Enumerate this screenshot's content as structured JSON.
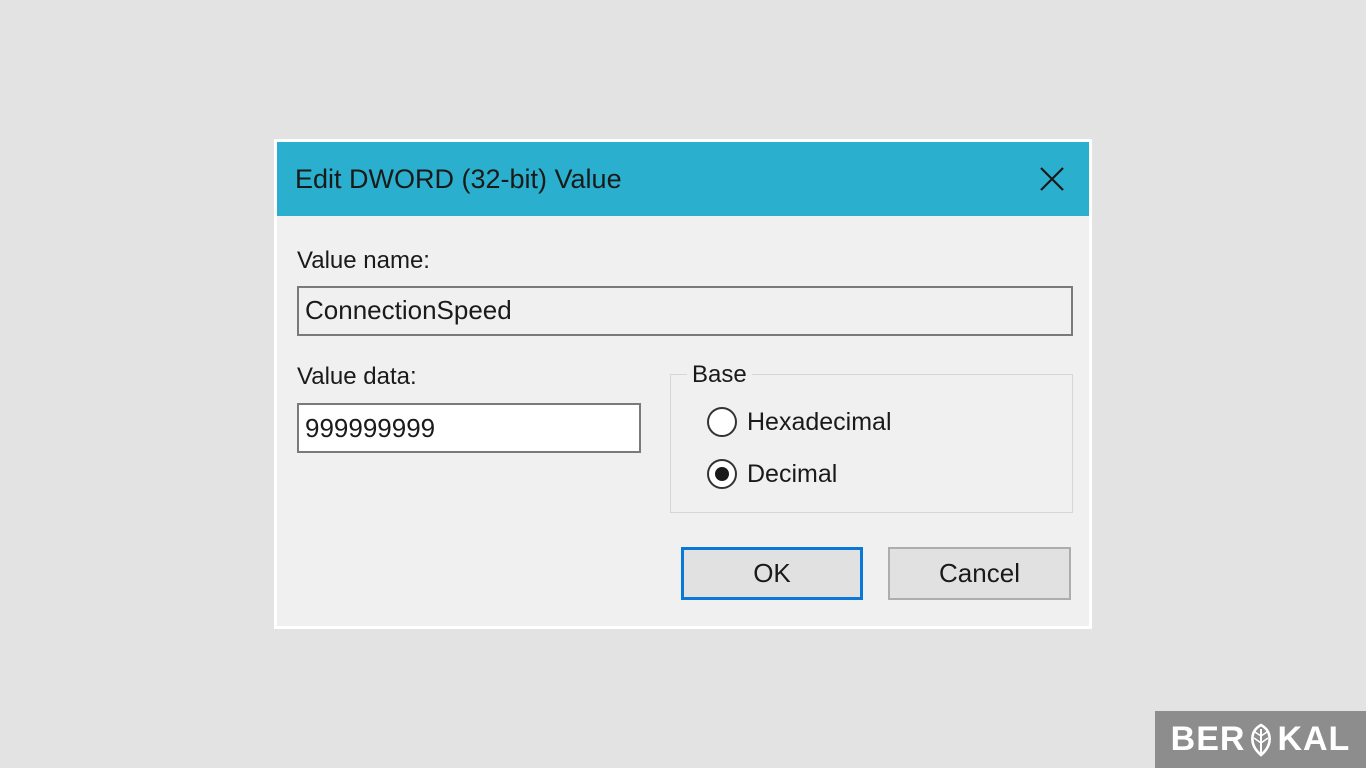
{
  "dialog": {
    "title": "Edit DWORD (32-bit) Value",
    "value_name_label": "Value name:",
    "value_name": "ConnectionSpeed",
    "value_data_label": "Value data:",
    "value_data": "999999999",
    "base": {
      "legend": "Base",
      "options": [
        {
          "label": "Hexadecimal",
          "selected": false
        },
        {
          "label": "Decimal",
          "selected": true
        }
      ]
    },
    "ok_label": "OK",
    "cancel_label": "Cancel"
  },
  "watermark": {
    "text_left": "BER",
    "text_right": "KAL"
  },
  "colors": {
    "titlebar": "#2aafce",
    "background": "#e3e3e3",
    "dialog_body": "#f0f0f0",
    "ok_border": "#0a78d7"
  }
}
